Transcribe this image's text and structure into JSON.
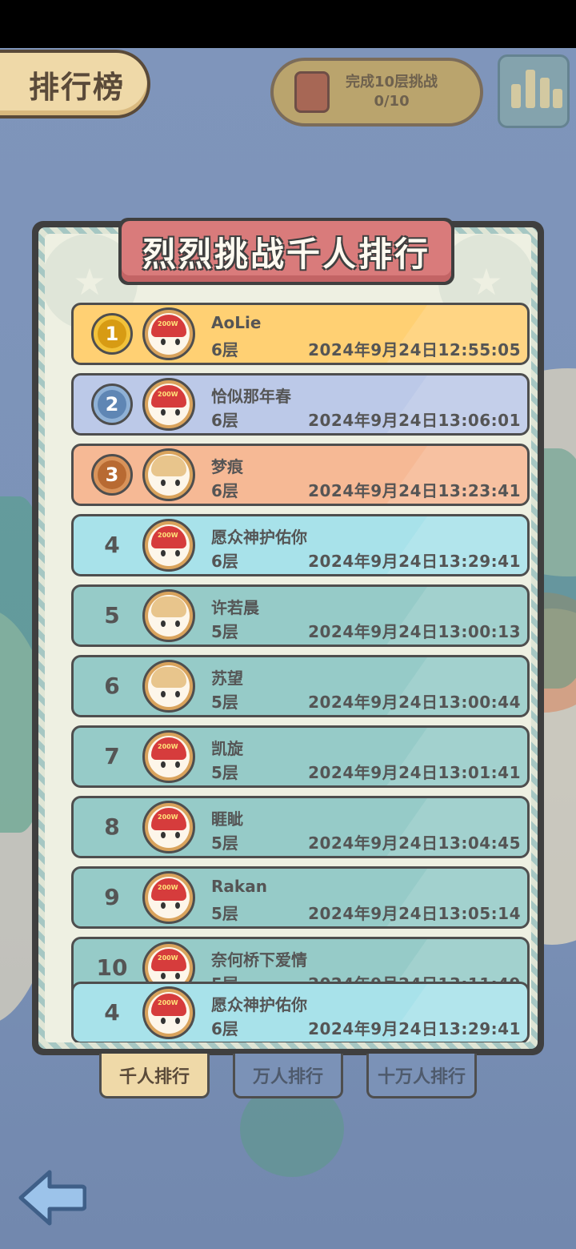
{
  "header": {
    "title": "排行榜"
  },
  "event": {
    "line1": "完成10层挑战",
    "line2": "0/10"
  },
  "board": {
    "title": "烈烈挑战千人排行"
  },
  "rows": [
    {
      "rank": "1",
      "name": "AoLie",
      "floor": "6层",
      "time": "2024年9月24日12:55:05"
    },
    {
      "rank": "2",
      "name": "恰似那年春",
      "floor": "6层",
      "time": "2024年9月24日13:06:01"
    },
    {
      "rank": "3",
      "name": "梦痕",
      "floor": "6层",
      "time": "2024年9月24日13:23:41"
    },
    {
      "rank": "4",
      "name": "愿众神护佑你",
      "floor": "6层",
      "time": "2024年9月24日13:29:41"
    },
    {
      "rank": "5",
      "name": "许若晨",
      "floor": "5层",
      "time": "2024年9月24日13:00:13"
    },
    {
      "rank": "6",
      "name": "苏望",
      "floor": "5层",
      "time": "2024年9月24日13:00:44"
    },
    {
      "rank": "7",
      "name": "凯旋",
      "floor": "5层",
      "time": "2024年9月24日13:01:41"
    },
    {
      "rank": "8",
      "name": "睚眦",
      "floor": "5层",
      "time": "2024年9月24日13:04:45"
    },
    {
      "rank": "9",
      "name": "Rakan",
      "floor": "5层",
      "time": "2024年9月24日13:05:14"
    },
    {
      "rank": "10",
      "name": "奈何桥下爱情",
      "floor": "5层",
      "time": "2024年9月24日13:11:49"
    }
  ],
  "self_row": {
    "rank": "4",
    "name": "愿众神护佑你",
    "floor": "6层",
    "time": "2024年9月24日13:29:41"
  },
  "tabs": [
    {
      "label": "千人排行",
      "active": true
    },
    {
      "label": "万人排行",
      "active": false
    },
    {
      "label": "十万人排行",
      "active": false
    }
  ],
  "colors": {
    "gold_row": "#ffd073",
    "silver_row": "#bcc9e8",
    "bronze_row": "#f6b995",
    "self_row": "#a8e2ea",
    "other_row": "#96cbc8"
  },
  "icons": {
    "back": "back-arrow-icon",
    "medal_1": "gold-medal-icon",
    "medal_2": "silver-medal-icon",
    "medal_3": "bronze-medal-icon"
  }
}
